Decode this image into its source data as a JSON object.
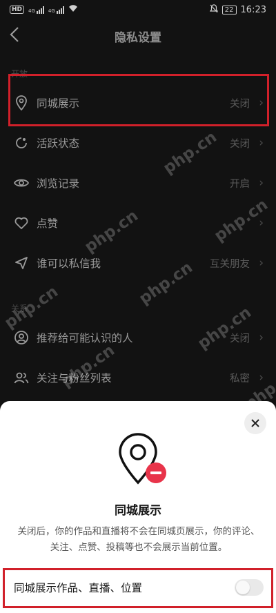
{
  "status_bar": {
    "carrier_badge": "HD",
    "signal_1": "4G",
    "signal_2": "4G",
    "battery": "22",
    "time": "16:23"
  },
  "header": {
    "title": "隐私设置",
    "back_icon": "chevron-left-icon"
  },
  "sections": {
    "section1_label": "开放",
    "section2_label": "关系"
  },
  "rows": [
    {
      "label": "同城展示",
      "value": "关闭",
      "icon": "location-pin-icon"
    },
    {
      "label": "活跃状态",
      "value": "关闭",
      "icon": "activity-icon"
    },
    {
      "label": "浏览记录",
      "value": "开启",
      "icon": "eye-icon"
    },
    {
      "label": "点赞",
      "value": "",
      "icon": "heart-icon"
    },
    {
      "label": "谁可以私信我",
      "value": "互关朋友",
      "icon": "send-icon"
    },
    {
      "label": "推荐给可能认识的人",
      "value": "关闭",
      "icon": "user-circle-icon"
    },
    {
      "label": "关注与粉丝列表",
      "value": "私密",
      "icon": "users-icon"
    }
  ],
  "watermark": "php.cn",
  "sheet": {
    "title": "同城展示",
    "description": "关闭后，你的作品和直播将不会在同城页展示，你的评论、关注、点赞、投稿等也不会展示当前位置。",
    "toggle_label": "同城展示作品、直播、位置",
    "toggle_on": false
  },
  "colors": {
    "highlight": "#d1202a",
    "badge_red": "#e8344a"
  }
}
